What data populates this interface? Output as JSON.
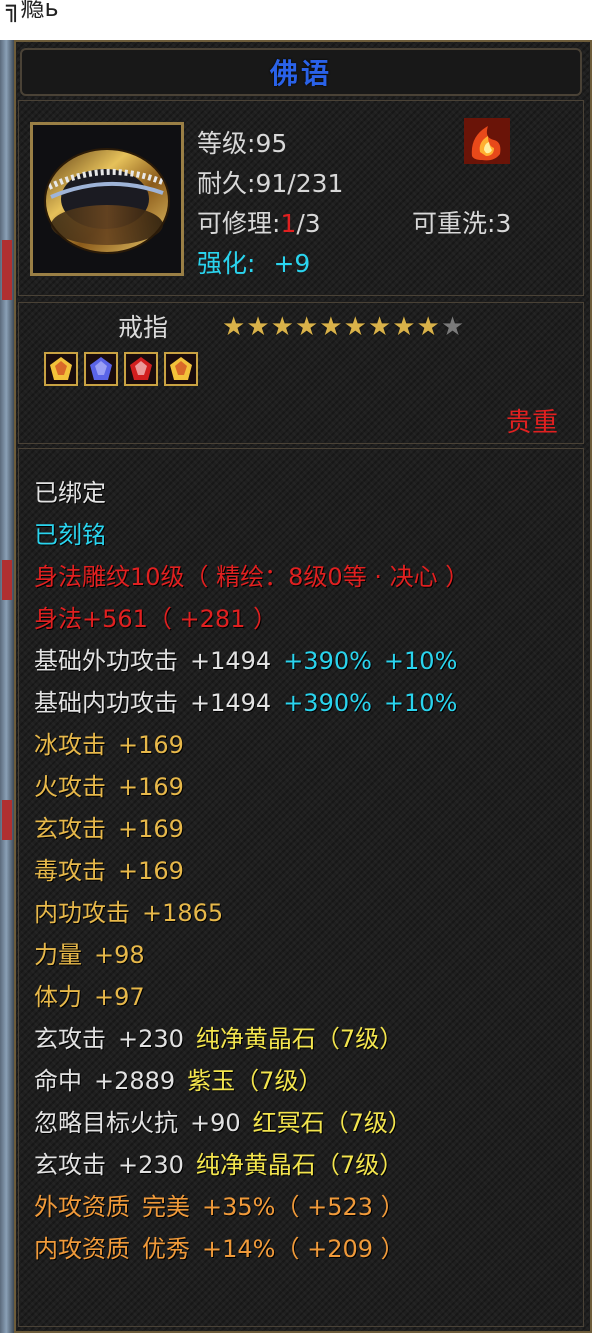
{
  "item": {
    "title": "佛语",
    "level_label": "等级",
    "level_value": "95",
    "durability_label": "耐久",
    "durability_value": "91/231",
    "repair_label": "可修理",
    "repair_current": "1",
    "repair_total": "/3",
    "rewash_label": "可重洗",
    "rewash_value": "3",
    "enhance_label": "强化:",
    "enhance_value": "+9",
    "name": "戒指",
    "stars_total": 10,
    "stars_filled": 9,
    "rarity": "贵重",
    "icons": {
      "ring": "ring-icon",
      "attribute": "flame-icon",
      "gems": [
        "gem-yellow-icon",
        "gem-purple-icon",
        "gem-red-icon",
        "gem-yellow-icon"
      ]
    }
  },
  "attributes": [
    {
      "segs": [
        {
          "t": "已绑定",
          "c": "white"
        }
      ]
    },
    {
      "segs": [
        {
          "t": "已刻铭",
          "c": "cyan"
        }
      ]
    },
    {
      "segs": [
        {
          "t": "身法雕纹10级（ 精绘：8级0等 · 决心 ）",
          "c": "red"
        }
      ]
    },
    {
      "segs": [
        {
          "t": "身法+561（ +281 ）",
          "c": "red"
        }
      ]
    },
    {
      "segs": [
        {
          "t": "基础外功攻击",
          "c": "white"
        },
        {
          "t": "+1494",
          "c": "white"
        },
        {
          "t": "+390%",
          "c": "cyan"
        },
        {
          "t": "+10%",
          "c": "cyan"
        }
      ]
    },
    {
      "segs": [
        {
          "t": "基础内功攻击",
          "c": "white"
        },
        {
          "t": "+1494",
          "c": "white"
        },
        {
          "t": "+390%",
          "c": "cyan"
        },
        {
          "t": "+10%",
          "c": "cyan"
        }
      ]
    },
    {
      "segs": [
        {
          "t": "冰攻击",
          "c": "gold"
        },
        {
          "t": "+169",
          "c": "gold"
        }
      ]
    },
    {
      "segs": [
        {
          "t": "火攻击",
          "c": "gold"
        },
        {
          "t": "+169",
          "c": "gold"
        }
      ]
    },
    {
      "segs": [
        {
          "t": "玄攻击",
          "c": "gold"
        },
        {
          "t": "+169",
          "c": "gold"
        }
      ]
    },
    {
      "segs": [
        {
          "t": "毒攻击",
          "c": "gold"
        },
        {
          "t": "+169",
          "c": "gold"
        }
      ]
    },
    {
      "segs": [
        {
          "t": "内功攻击",
          "c": "gold"
        },
        {
          "t": "+1865",
          "c": "gold"
        }
      ]
    },
    {
      "segs": [
        {
          "t": "力量",
          "c": "gold"
        },
        {
          "t": "+98",
          "c": "gold"
        }
      ]
    },
    {
      "segs": [
        {
          "t": "体力",
          "c": "gold"
        },
        {
          "t": "+97",
          "c": "gold"
        }
      ]
    },
    {
      "segs": [
        {
          "t": "玄攻击",
          "c": "white"
        },
        {
          "t": "+230",
          "c": "white"
        },
        {
          "t": "纯净黄晶石（7级）",
          "c": "yellow"
        }
      ]
    },
    {
      "segs": [
        {
          "t": "命中",
          "c": "white"
        },
        {
          "t": "+2889",
          "c": "white"
        },
        {
          "t": "紫玉（7级）",
          "c": "yellow"
        }
      ]
    },
    {
      "segs": [
        {
          "t": "忽略目标火抗",
          "c": "white"
        },
        {
          "t": "+90",
          "c": "white"
        },
        {
          "t": "红冥石（7级）",
          "c": "yellow"
        }
      ]
    },
    {
      "segs": [
        {
          "t": "玄攻击",
          "c": "white"
        },
        {
          "t": "+230",
          "c": "white"
        },
        {
          "t": "纯净黄晶石（7级）",
          "c": "yellow"
        }
      ]
    },
    {
      "segs": [
        {
          "t": "外攻资质",
          "c": "orange"
        },
        {
          "t": "完美",
          "c": "orange"
        },
        {
          "t": "+35%（ +523 ）",
          "c": "orange"
        }
      ]
    },
    {
      "segs": [
        {
          "t": "内攻资质",
          "c": "orange"
        },
        {
          "t": "优秀",
          "c": "orange"
        },
        {
          "t": "+14%（ +209 ）",
          "c": "orange"
        }
      ]
    }
  ]
}
